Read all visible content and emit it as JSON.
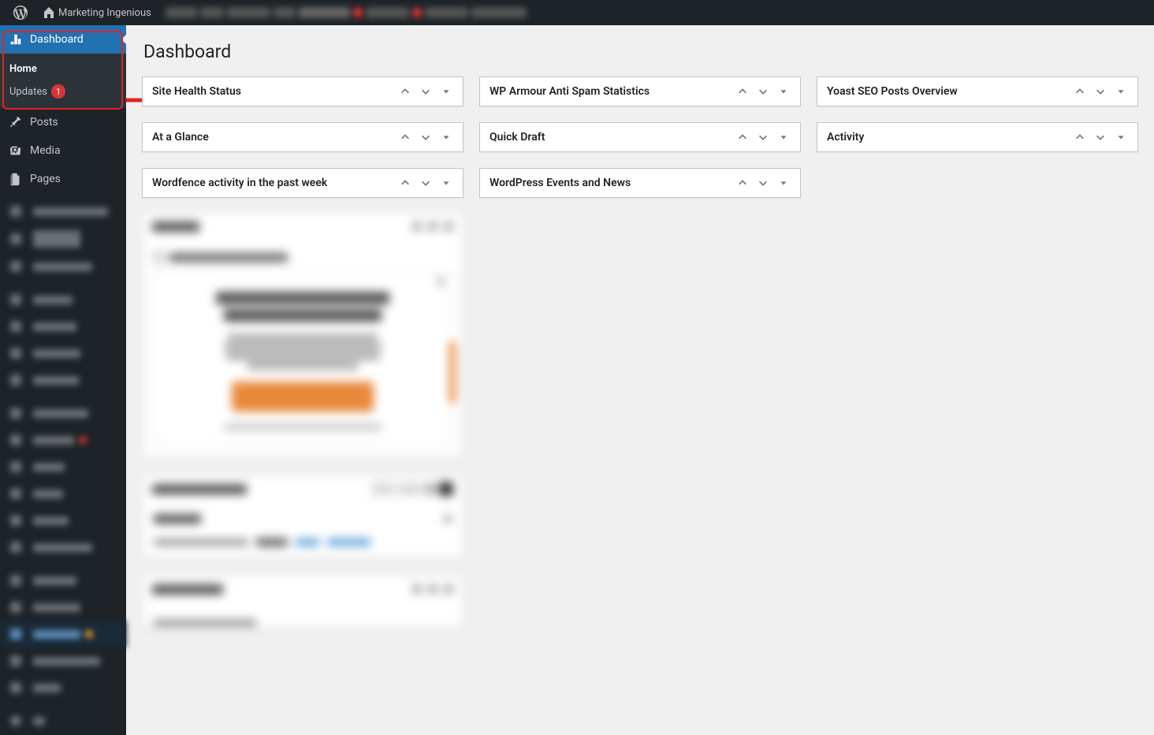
{
  "adminBar": {
    "siteName": "Marketing Ingenious"
  },
  "sidebar": {
    "dashboard": {
      "label": "Dashboard"
    },
    "submenu": {
      "home": "Home",
      "updates": "Updates",
      "updatesBadge": "1"
    },
    "posts": "Posts",
    "media": "Media",
    "pages": "Pages"
  },
  "content": {
    "title": "Dashboard"
  },
  "widgets": {
    "siteHealth": "Site Health Status",
    "wpArmour": "WP Armour Anti Spam Statistics",
    "yoast": "Yoast SEO Posts Overview",
    "atAGlance": "At a Glance",
    "quickDraft": "Quick Draft",
    "activity": "Activity",
    "wordfence": "Wordfence activity in the past week",
    "events": "WordPress Events and News"
  }
}
